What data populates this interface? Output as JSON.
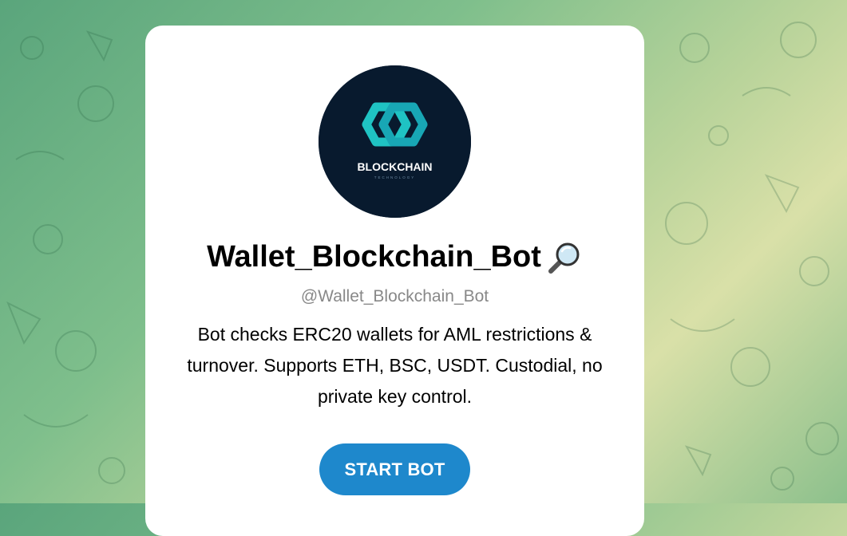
{
  "bot": {
    "name": "Wallet_Blockchain_Bot",
    "username": "@Wallet_Blockchain_Bot",
    "description": "Bot checks ERC20 wallets for AML restrictions & turnover. Supports ETH, BSC, USDT. Custodial, no private key control.",
    "title_icon": "magnifying-glass-icon"
  },
  "avatar": {
    "logo_text": "BLOCKCHAIN",
    "logo_subtext": "TECHNOLOGY",
    "background_color": "#081a2e",
    "accent_color": "#1fc3c3"
  },
  "actions": {
    "start_label": "START BOT"
  },
  "colors": {
    "button": "#1e88cc",
    "card": "#ffffff"
  }
}
